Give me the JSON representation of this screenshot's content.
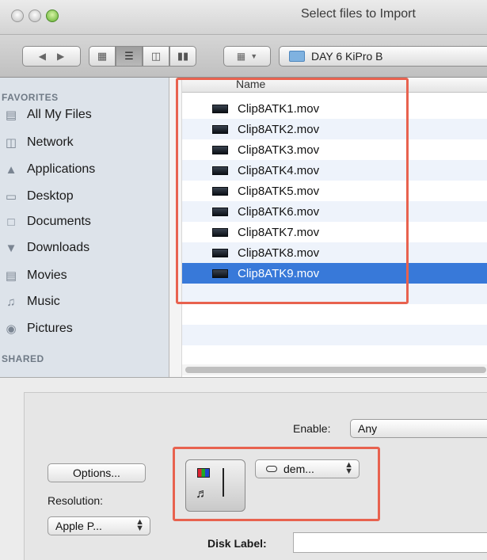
{
  "window": {
    "title": "Select files to Import"
  },
  "toolbar": {
    "path_label": "DAY 6 KiPro B"
  },
  "sidebar": {
    "favorites_header": "FAVORITES",
    "shared_header": "SHARED",
    "items": [
      {
        "label": "All My Files",
        "icon": "all-files-icon"
      },
      {
        "label": "Network",
        "icon": "network-icon"
      },
      {
        "label": "Applications",
        "icon": "applications-icon"
      },
      {
        "label": "Desktop",
        "icon": "desktop-icon"
      },
      {
        "label": "Documents",
        "icon": "documents-icon"
      },
      {
        "label": "Downloads",
        "icon": "downloads-icon"
      },
      {
        "label": "Movies",
        "icon": "movies-icon"
      },
      {
        "label": "Music",
        "icon": "music-icon"
      },
      {
        "label": "Pictures",
        "icon": "pictures-icon"
      }
    ]
  },
  "file_list": {
    "column_name": "Name",
    "files": [
      "Clip8ATK1.mov",
      "Clip8ATK2.mov",
      "Clip8ATK3.mov",
      "Clip8ATK4.mov",
      "Clip8ATK5.mov",
      "Clip8ATK6.mov",
      "Clip8ATK7.mov",
      "Clip8ATK8.mov",
      "Clip8ATK9.mov"
    ],
    "selected": "Clip8ATK9.mov"
  },
  "options": {
    "enable_label": "Enable:",
    "enable_value": "Any",
    "options_button": "Options...",
    "resolution_label": "Resolution:",
    "resolution_value": "Apple P...",
    "device_value": "dem...",
    "disk_label": "Disk Label:",
    "disk_label_value": ""
  },
  "colors": {
    "selection": "#3879d9",
    "annotation": "#e8624f",
    "sidebar_bg": "#dde3ea"
  }
}
